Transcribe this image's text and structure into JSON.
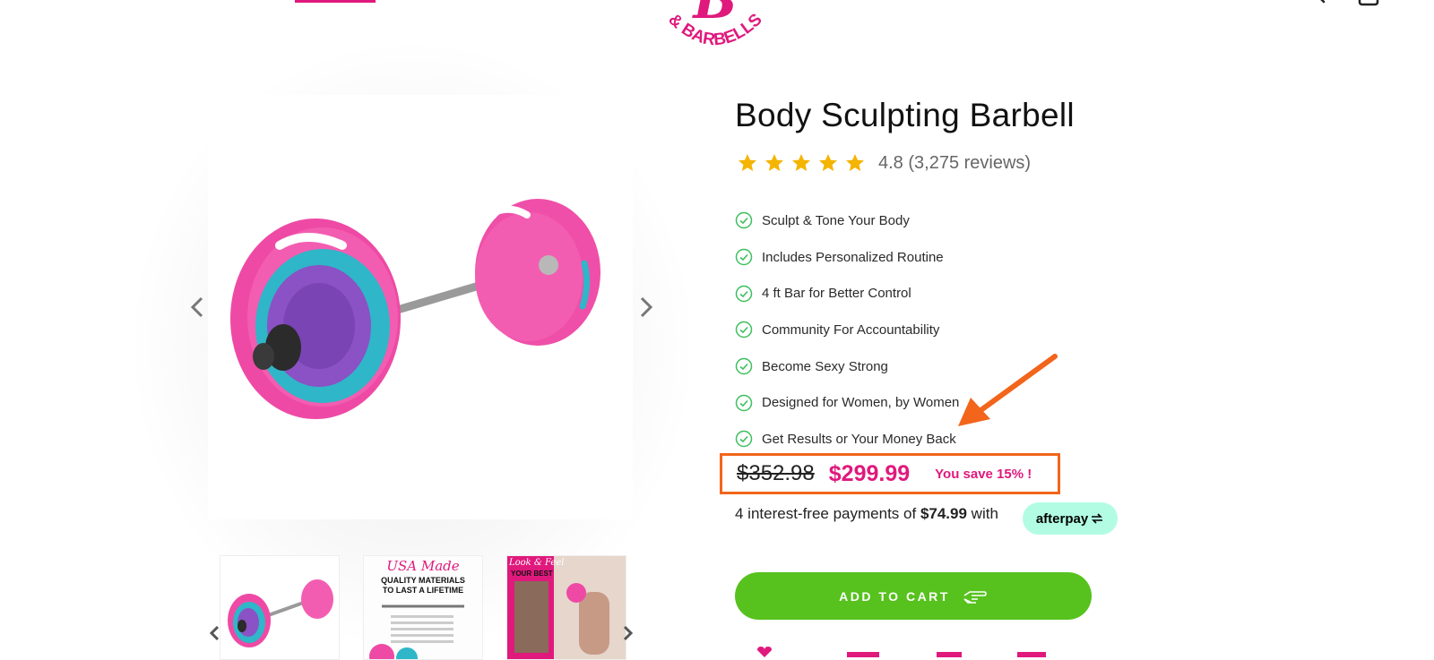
{
  "colors": {
    "brand_pink": "#e0197d",
    "cta_green": "#57c21e",
    "afterpay_mint": "#b2fce4",
    "annotation_orange": "#f2651b",
    "star_gold": "#f4b400"
  },
  "header": {
    "logo_text": "& BARBELLS",
    "icons": [
      "search-icon",
      "cart-icon"
    ]
  },
  "product": {
    "title": "Body Sculpting Barbell",
    "rating": {
      "stars": 5,
      "text": "4.8 (3,275 reviews)"
    },
    "features": [
      "Sculpt & Tone Your Body",
      "Includes Personalized Routine",
      "4 ft Bar for Better Control",
      "Community For Accountability",
      "Become Sexy Strong",
      "Designed for Women, by Women",
      "Get Results or Your Money Back"
    ],
    "price": {
      "old": "$352.98",
      "new": "$299.99",
      "save": "You save 15% !"
    },
    "afterpay": {
      "prefix": "4 interest-free payments of ",
      "amount": "$74.99",
      "suffix": " with",
      "badge": "afterpay"
    },
    "add_to_cart": "ADD TO CART"
  },
  "gallery": {
    "thumbs": [
      {
        "name": "barbell-thumb"
      },
      {
        "name": "materials-thumb",
        "heading": "USA Made",
        "subheading": "QUALITY MATERIALS TO LAST A LIFETIME"
      },
      {
        "name": "look-feel-thumb",
        "heading": "Look & Feel",
        "subheading": "YOUR BEST"
      }
    ]
  }
}
